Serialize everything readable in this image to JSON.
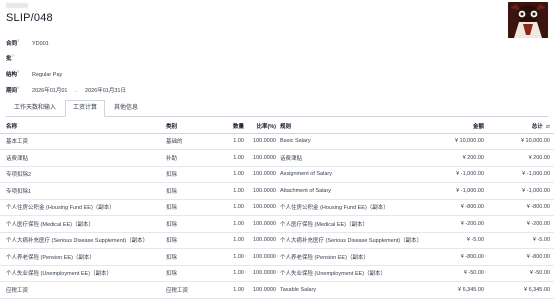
{
  "header": {
    "title": "SLIP/048"
  },
  "fields": {
    "contract": {
      "label": "合同",
      "help": "?",
      "value": "YD001"
    },
    "batch": {
      "label": "批",
      "help": "?",
      "value": ""
    },
    "structure": {
      "label": "结构",
      "help": "?",
      "value": "Regular Pay"
    },
    "period": {
      "label": "期间",
      "help": "?",
      "from": "2026年01月01",
      "separator": "→",
      "to": "2026年01月31日"
    }
  },
  "tabs": [
    {
      "label": "工作天数和输入",
      "active": false
    },
    {
      "label": "工资计算",
      "active": true
    },
    {
      "label": "其他信息",
      "active": false
    }
  ],
  "table": {
    "headers": {
      "name": "名称",
      "category": "类别",
      "quantity": "数量",
      "rate": "比率(%)",
      "rule": "规则",
      "amount": "金额",
      "total": "总计",
      "adjust_icon": "⇄"
    },
    "rows": [
      {
        "name": "基本工资",
        "category": "基础的",
        "quantity": "1.00",
        "rate": "100.0000",
        "rule": "Basic Salary",
        "amount": "¥ 10,000.00",
        "total": "¥ 10,000.00"
      },
      {
        "name": "话费津贴",
        "category": "补助",
        "quantity": "1.00",
        "rate": "100.0000",
        "rule": "话费津贴",
        "amount": "¥ 200.00",
        "total": "¥ 200.00"
      },
      {
        "name": "专项扣除2",
        "category": "扣除",
        "quantity": "1.00",
        "rate": "100.0000",
        "rule": "Assignment of Salary",
        "amount": "¥ -1,000.00",
        "total": "¥ -1,000.00"
      },
      {
        "name": "专项扣除1",
        "category": "扣除",
        "quantity": "1.00",
        "rate": "100.0000",
        "rule": "Attachment of Salary",
        "amount": "¥ -1,000.00",
        "total": "¥ -1,000.00"
      },
      {
        "name": "个人住房公积金 (Housing Fund EE)（副本）",
        "category": "扣除",
        "quantity": "1.00",
        "rate": "100.0000",
        "rule": "个人住房公积金 (Housing Fund EE)（副本）",
        "amount": "¥ -800.00",
        "total": "¥ -800.00"
      },
      {
        "name": "个人医疗保险 (Medical EE)（副本）",
        "category": "扣除",
        "quantity": "1.00",
        "rate": "100.0000",
        "rule": "个人医疗保险 (Medical EE)（副本）",
        "amount": "¥ -200.00",
        "total": "¥ -200.00"
      },
      {
        "name": "个人大病补充医疗 (Serious Disease Supplement)（副本）",
        "category": "扣除",
        "quantity": "1.00",
        "rate": "100.0000",
        "rule": "个人大病补充医疗 (Serious Disease Supplement)（副本）",
        "amount": "¥ -5.00",
        "total": "¥ -5.00"
      },
      {
        "name": "个人养老保险 (Pension EE)（副本）",
        "category": "扣除",
        "quantity": "1.00",
        "rate": "100.0000",
        "rule": "个人养老保险 (Pension EE)（副本）",
        "amount": "¥ -800.00",
        "total": "¥ -800.00"
      },
      {
        "name": "个人失业保险 (Unemployment EE)（副本）",
        "category": "扣除",
        "quantity": "1.00",
        "rate": "100.0000",
        "rule": "个人失业保险 (Unemployment EE)（副本）",
        "amount": "¥ -50.00",
        "total": "¥ -50.00"
      },
      {
        "name": "应税工资",
        "category": "应税工资",
        "quantity": "1.00",
        "rate": "100.0000",
        "rule": "Taxable Salary",
        "amount": "¥ 6,345.00",
        "total": "¥ 6,345.00"
      }
    ]
  }
}
